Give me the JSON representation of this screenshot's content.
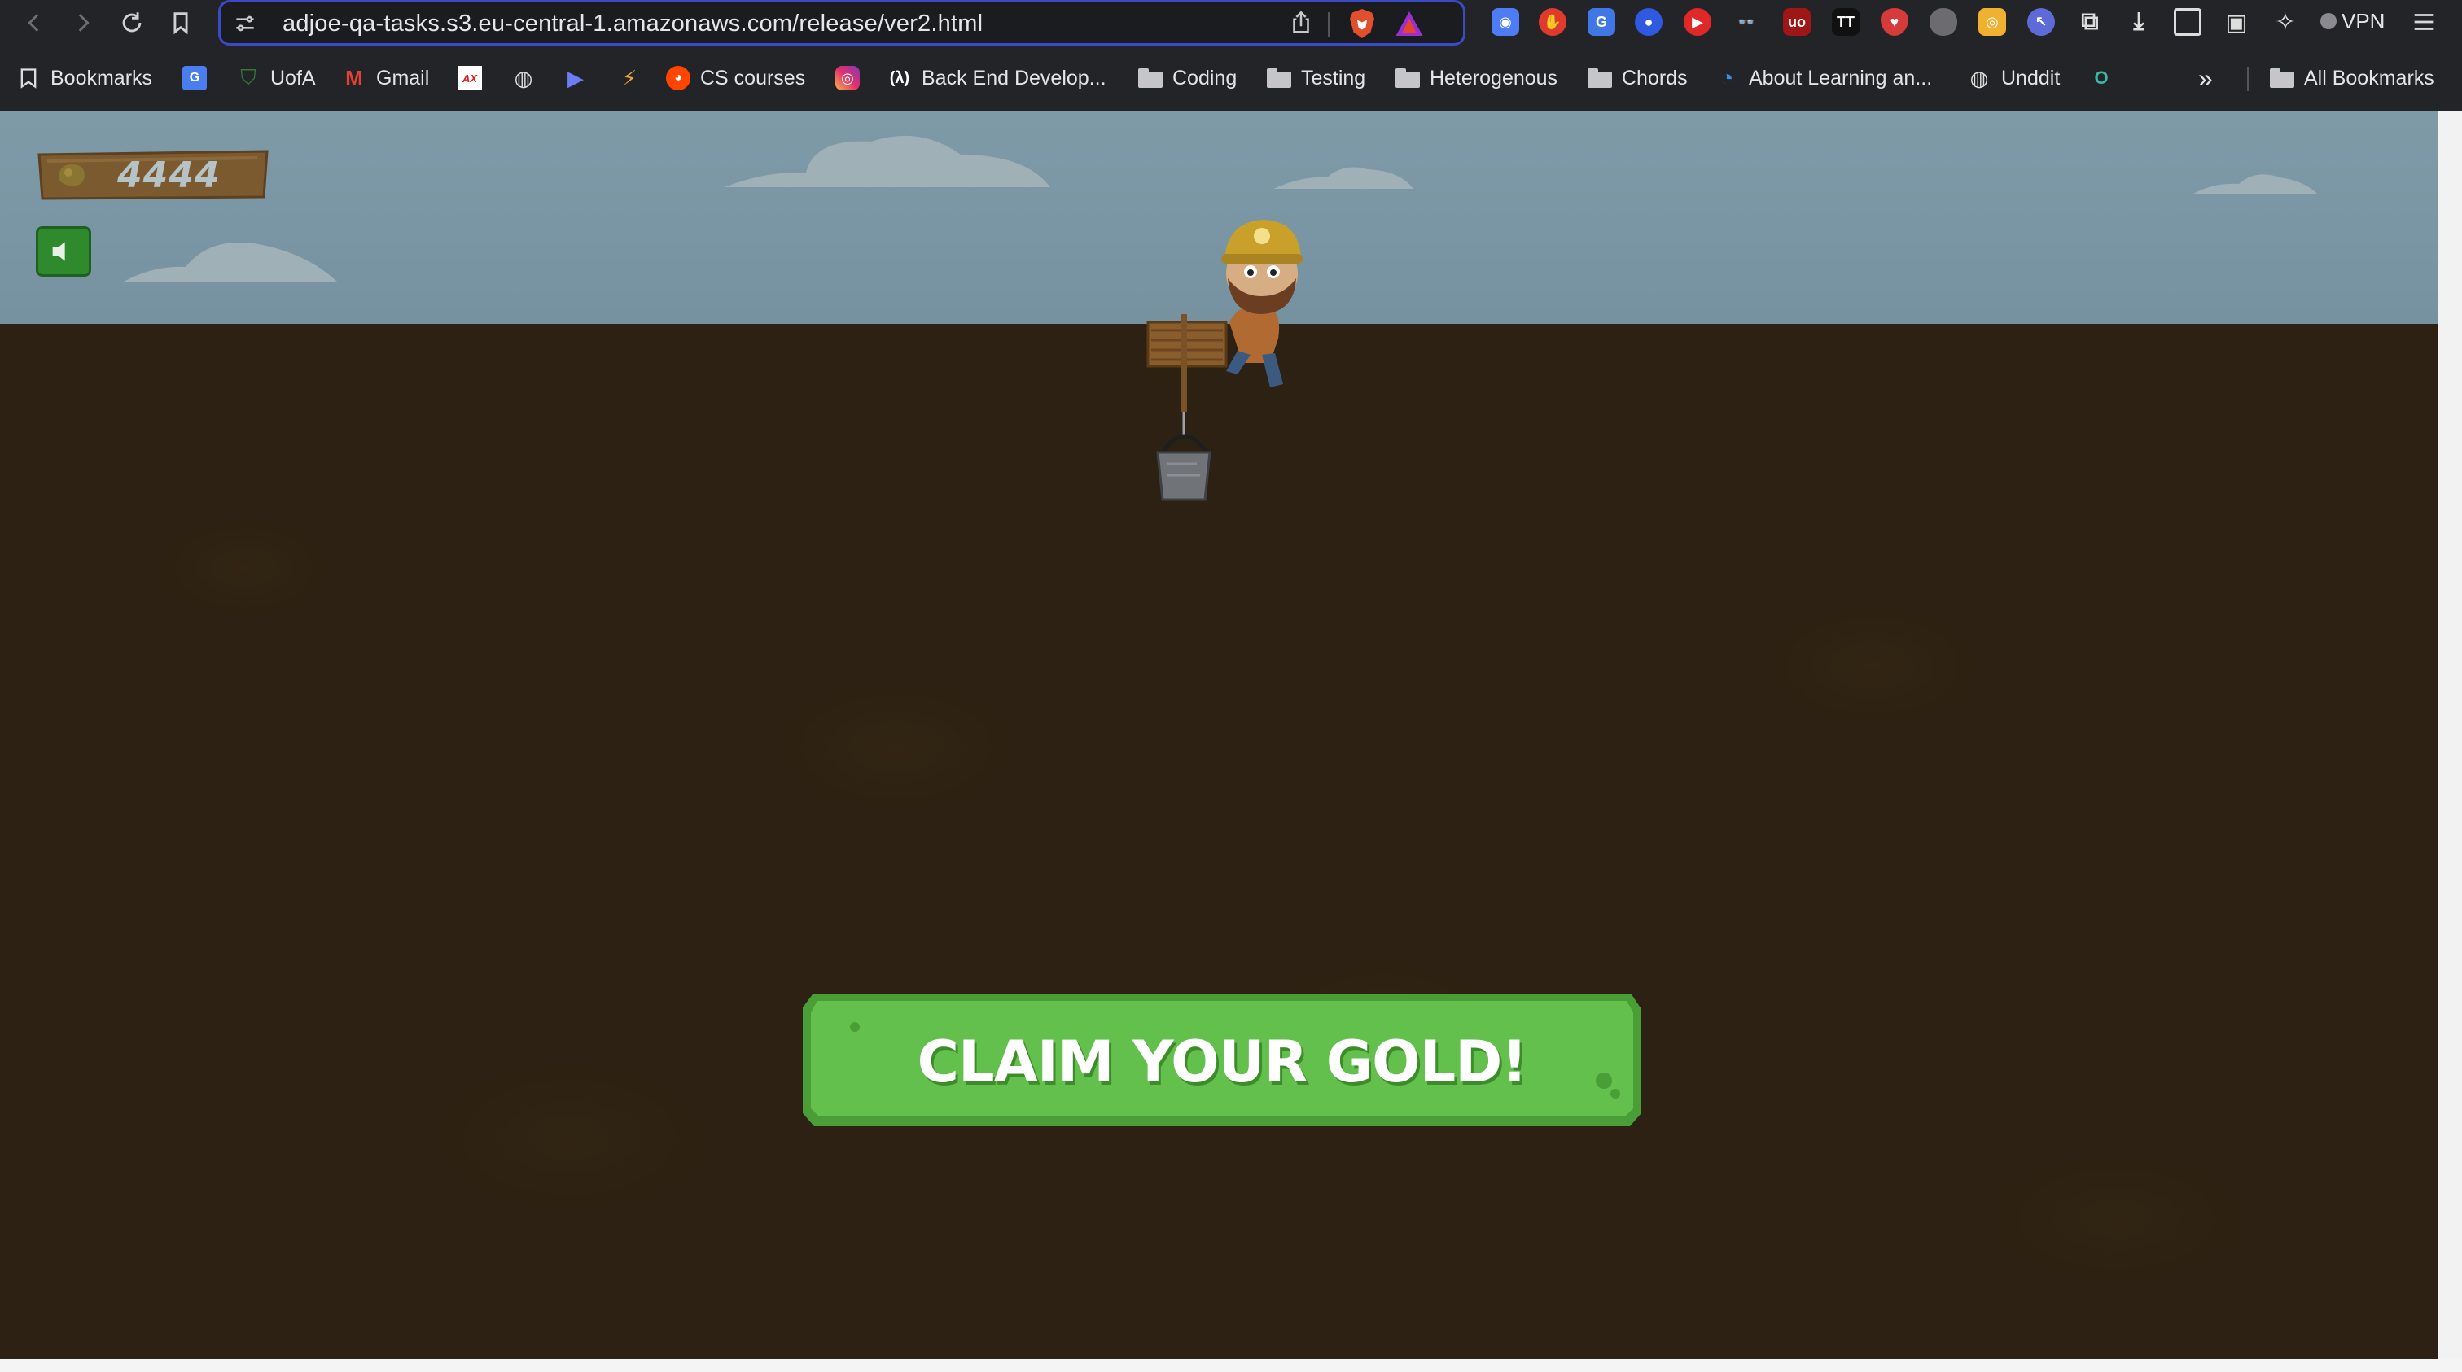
{
  "browser": {
    "url": "adjoe-qa-tasks.s3.eu-central-1.amazonaws.com/release/ver2.html",
    "vpn_label": "VPN",
    "bookmarks": [
      {
        "label": "Bookmarks",
        "icon": "bookmarks-list-icon"
      },
      {
        "label": "",
        "icon": "google-translate-icon"
      },
      {
        "label": "UofA",
        "icon": "shield-crest-icon"
      },
      {
        "label": "Gmail",
        "icon": "gmail-icon"
      },
      {
        "label": "",
        "icon": "ae-logo-icon"
      },
      {
        "label": "",
        "icon": "globe-icon"
      },
      {
        "label": "",
        "icon": "play-arrow-icon"
      },
      {
        "label": "",
        "icon": "lightning-icon"
      },
      {
        "label": "CS courses",
        "icon": "reddit-icon"
      },
      {
        "label": "",
        "icon": "instagram-icon"
      },
      {
        "label": "Back End Develop...",
        "icon": "lambda-icon"
      },
      {
        "label": "Coding",
        "icon": "folder-icon"
      },
      {
        "label": "Testing",
        "icon": "folder-icon"
      },
      {
        "label": "Heterogenous",
        "icon": "folder-icon"
      },
      {
        "label": "Chords",
        "icon": "folder-icon"
      },
      {
        "label": "About Learning an...",
        "icon": "edge-icon"
      },
      {
        "label": "Unddit",
        "icon": "globe-icon"
      },
      {
        "label": "",
        "icon": "circle-o-icon"
      }
    ],
    "all_bookmarks_label": "All Bookmarks",
    "overflow_label": "»"
  },
  "game": {
    "score": "4444",
    "claim_button_label": "CLAIM YOUR GOLD!",
    "sound_icon": "speaker-icon"
  },
  "colors": {
    "sky": "#7f9aa7",
    "ground": "#2c2112",
    "button_green": "#5fbd4a",
    "button_border": "#4a9e36",
    "url_focus": "#3b4ac7"
  }
}
